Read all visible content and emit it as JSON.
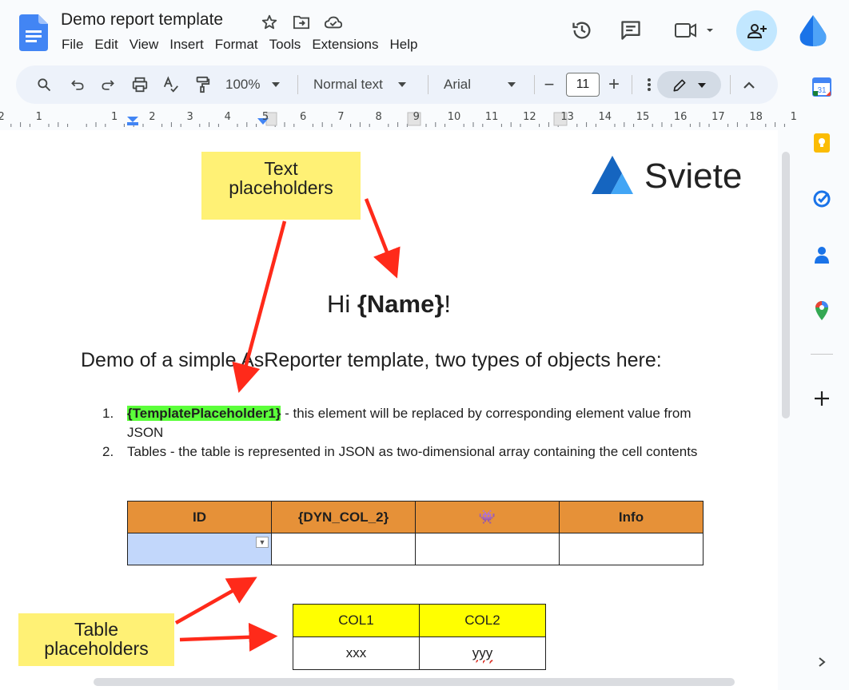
{
  "app": {
    "doc_title": "Demo report template",
    "menu": [
      "File",
      "Edit",
      "View",
      "Insert",
      "Format",
      "Tools",
      "Extensions",
      "Help"
    ]
  },
  "toolbar": {
    "zoom": "100%",
    "style": "Normal text",
    "font": "Arial",
    "font_size": "11",
    "minus": "−",
    "plus": "+"
  },
  "ruler": {
    "numbers": [
      "2",
      "1",
      "1",
      "2",
      "3",
      "4",
      "5",
      "6",
      "7",
      "8",
      "9",
      "10",
      "11",
      "12",
      "13",
      "14",
      "15",
      "16",
      "17",
      "18",
      "1"
    ]
  },
  "annotations": {
    "text_placeholders": "Text\nplaceholders",
    "table_placeholders": "Table\nplaceholders"
  },
  "logo": {
    "text": "Sviete"
  },
  "document": {
    "greeting_prefix": "Hi ",
    "greeting_name": "{Name}",
    "greeting_suffix": "!",
    "subtitle": "Demo of a simple AsReporter template, two types of objects here:",
    "list": [
      {
        "num": "1.",
        "highlight": "{TemplatePlaceholder1}",
        "text": " - this element will be replaced by corresponding element value from JSON"
      },
      {
        "num": "2.",
        "text": "Tables - the table is represented in JSON as two-dimensional array containing the cell contents"
      }
    ],
    "dyn_table": {
      "headers": [
        "ID",
        "{DYN_COL_2}",
        "👾",
        "Info"
      ],
      "row": [
        "",
        "",
        "",
        ""
      ]
    },
    "simple_table": {
      "headers": [
        "COL1",
        "COL2"
      ],
      "row": [
        "xxx",
        "yyy"
      ]
    }
  },
  "colors": {
    "accent": "#0b57d0",
    "note_yellow": "#fff175",
    "arrow_red": "#ff2a1a",
    "header_orange": "#e69138",
    "highlight_green": "#5bff3a"
  }
}
